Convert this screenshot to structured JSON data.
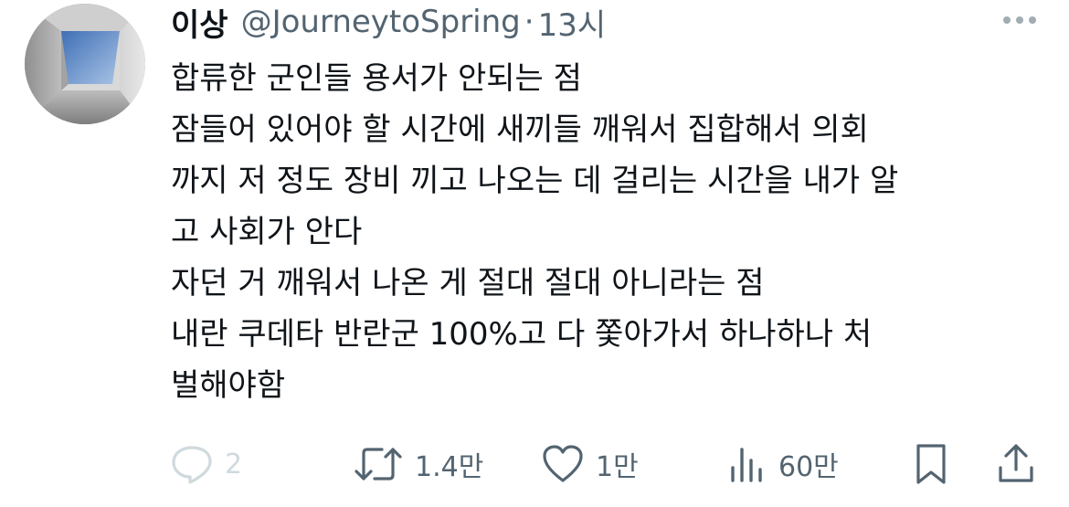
{
  "tweet": {
    "display_name": "이상",
    "handle": "@JourneytoSpring",
    "separator": "·",
    "time": "13시",
    "lines": [
      "합류한 군인들 용서가 안되는 점",
      "잠들어 있어야 할 시간에 새끼들 깨워서 집합해서 의회",
      "까지 저 정도 장비 끼고 나오는 데 걸리는 시간을 내가 알",
      "고 사회가 안다",
      "자던 거 깨워서 나온 게 절대 절대 아니라는 점",
      "내란 쿠데타 반란군 100%고 다 쫓아가서 하나하나 처",
      "벌해야함"
    ]
  },
  "actions": {
    "reply": {
      "icon": "reply-icon",
      "count": "2"
    },
    "retweet": {
      "icon": "retweet-icon",
      "count": "1.4만"
    },
    "like": {
      "icon": "heart-icon",
      "count": "1만"
    },
    "views": {
      "icon": "views-icon",
      "count": "60만"
    },
    "bookmark": {
      "icon": "bookmark-icon"
    },
    "share": {
      "icon": "share-icon"
    }
  },
  "colors": {
    "text": "#0f1419",
    "muted": "#536471",
    "faded": "#cfd9de",
    "background": "#ffffff"
  }
}
